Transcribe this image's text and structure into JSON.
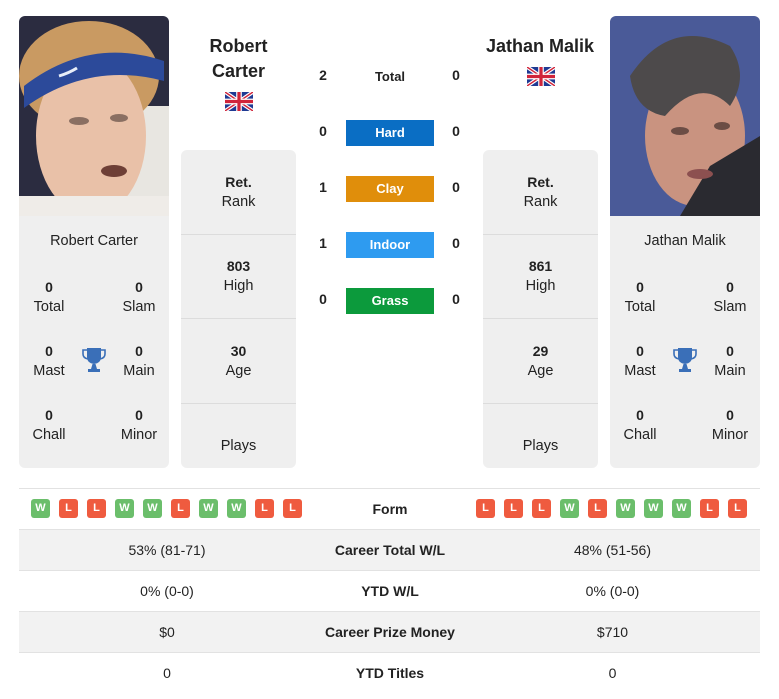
{
  "players": {
    "left": {
      "name": "Robert Carter",
      "name_line1": "Robert",
      "name_line2": "Carter",
      "flag": "uk-flag",
      "rank_value": "Ret.",
      "rank_label": "Rank",
      "high_value": "803",
      "high_label": "High",
      "age_value": "30",
      "age_label": "Age",
      "plays_label": "Plays",
      "titles": {
        "total": {
          "value": "0",
          "label": "Total"
        },
        "slam": {
          "value": "0",
          "label": "Slam"
        },
        "mast": {
          "value": "0",
          "label": "Mast"
        },
        "main": {
          "value": "0",
          "label": "Main"
        },
        "chall": {
          "value": "0",
          "label": "Chall"
        },
        "minor": {
          "value": "0",
          "label": "Minor"
        }
      },
      "form": [
        "W",
        "L",
        "L",
        "W",
        "W",
        "L",
        "W",
        "W",
        "L",
        "L"
      ],
      "career_wl": "53% (81-71)",
      "ytd_wl": "0% (0-0)",
      "prize_money": "$0",
      "ytd_titles": "0"
    },
    "right": {
      "name": "Jathan Malik",
      "flag": "uk-flag",
      "rank_value": "Ret.",
      "rank_label": "Rank",
      "high_value": "861",
      "high_label": "High",
      "age_value": "29",
      "age_label": "Age",
      "plays_label": "Plays",
      "titles": {
        "total": {
          "value": "0",
          "label": "Total"
        },
        "slam": {
          "value": "0",
          "label": "Slam"
        },
        "mast": {
          "value": "0",
          "label": "Mast"
        },
        "main": {
          "value": "0",
          "label": "Main"
        },
        "chall": {
          "value": "0",
          "label": "Chall"
        },
        "minor": {
          "value": "0",
          "label": "Minor"
        }
      },
      "form": [
        "L",
        "L",
        "L",
        "W",
        "L",
        "W",
        "W",
        "W",
        "L",
        "L"
      ],
      "career_wl": "48% (51-56)",
      "ytd_wl": "0% (0-0)",
      "prize_money": "$710",
      "ytd_titles": "0"
    }
  },
  "h2h": {
    "total": {
      "label": "Total",
      "left": "2",
      "right": "0"
    },
    "surfaces": [
      {
        "label": "Hard",
        "left": "0",
        "right": "0",
        "color": "#0a6ec4"
      },
      {
        "label": "Clay",
        "left": "1",
        "right": "0",
        "color": "#e08e0b"
      },
      {
        "label": "Indoor",
        "left": "1",
        "right": "0",
        "color": "#2e9bf0"
      },
      {
        "label": "Grass",
        "left": "0",
        "right": "0",
        "color": "#0c9a3c"
      }
    ]
  },
  "table": {
    "form_label": "Form",
    "career_wl_label": "Career Total W/L",
    "ytd_wl_label": "YTD W/L",
    "prize_label": "Career Prize Money",
    "ytd_titles_label": "YTD Titles"
  },
  "colors": {
    "win": "#5cb85c",
    "loss": "#ef5b3f",
    "trophy": "#3a6fb8"
  }
}
